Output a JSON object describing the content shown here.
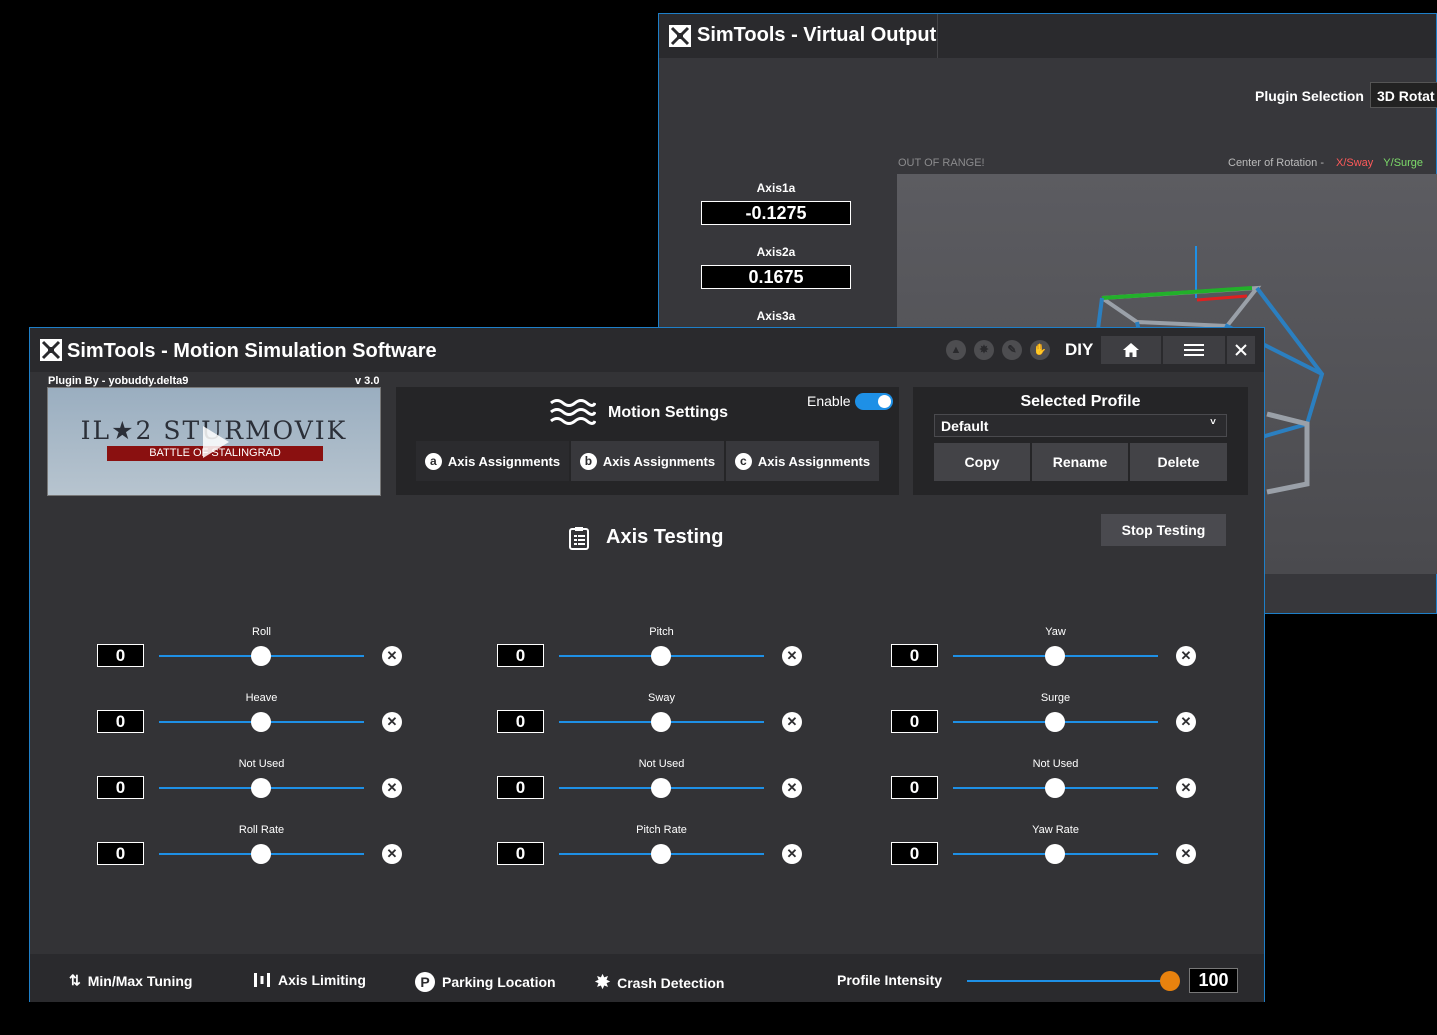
{
  "virtual_output": {
    "title": "SimTools - Virtual Output",
    "plugin_selection_label": "Plugin Selection",
    "plugin_selection_value": "3D Rotat",
    "out_of_range": "OUT OF RANGE!",
    "center_of_rotation": "Center of Rotation -",
    "x_label": "X/Sway",
    "y_label": "Y/Surge",
    "axes": [
      {
        "label": "Axis1a",
        "value": "-0.1275"
      },
      {
        "label": "Axis2a",
        "value": "0.1675"
      },
      {
        "label": "Axis3a"
      }
    ]
  },
  "main": {
    "title": "SimTools - Motion Simulation Software",
    "title_icons": [
      "arrow-up-icon",
      "burst-icon",
      "wrench-icon",
      "hand-icon"
    ],
    "diy": "DIY",
    "plugin_by": "Plugin By - yobuddy.delta9",
    "version": "v 3.0",
    "game_title": "IL★2 STURMOVIK",
    "game_subtitle": "BATTLE OF STALINGRAD",
    "motion_settings": {
      "title": "Motion Settings",
      "enable_label": "Enable",
      "enabled": true,
      "tabs": [
        {
          "letter": "a",
          "label": "Axis Assignments"
        },
        {
          "letter": "b",
          "label": "Axis Assignments"
        },
        {
          "letter": "c",
          "label": "Axis Assignments"
        }
      ]
    },
    "selected_profile": {
      "title": "Selected Profile",
      "value": "Default",
      "buttons": [
        "Copy",
        "Rename",
        "Delete"
      ]
    },
    "axis_testing": {
      "title": "Axis Testing",
      "stop_button": "Stop Testing",
      "sliders": [
        {
          "label": "Roll",
          "value": "0"
        },
        {
          "label": "Pitch",
          "value": "0"
        },
        {
          "label": "Yaw",
          "value": "0"
        },
        {
          "label": "Heave",
          "value": "0"
        },
        {
          "label": "Sway",
          "value": "0"
        },
        {
          "label": "Surge",
          "value": "0"
        },
        {
          "label": "Not Used",
          "value": "0"
        },
        {
          "label": "Not Used",
          "value": "0"
        },
        {
          "label": "Not Used",
          "value": "0"
        },
        {
          "label": "Roll Rate",
          "value": "0"
        },
        {
          "label": "Pitch Rate",
          "value": "0"
        },
        {
          "label": "Yaw Rate",
          "value": "0"
        }
      ]
    },
    "bottom_bar": {
      "minmax": "Min/Max Tuning",
      "limiting": "Axis Limiting",
      "parking": "Parking Location",
      "crash": "Crash Detection",
      "intensity_label": "Profile Intensity",
      "intensity_value": "100"
    }
  },
  "colors": {
    "accent": "#1e90e6",
    "intensity_knob": "#e8820e",
    "window_border": "#1e7fc8"
  }
}
